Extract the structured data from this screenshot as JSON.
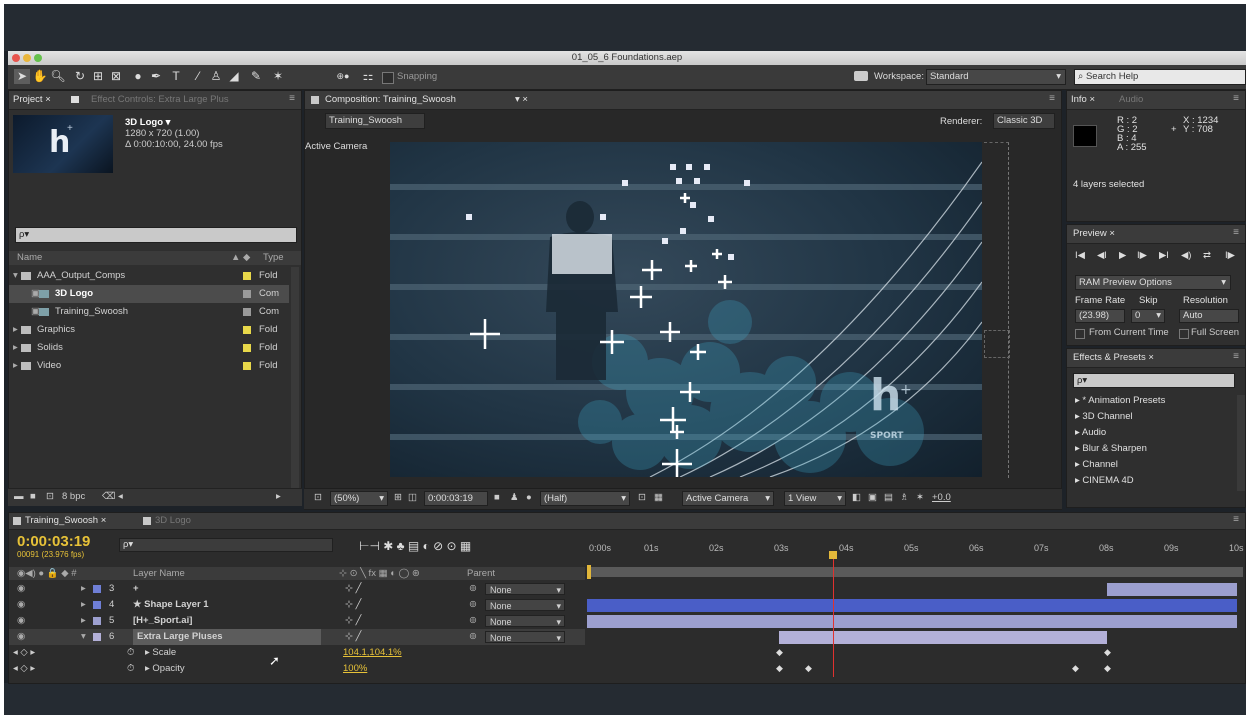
{
  "app": {
    "window_title": "01_05_6 Foundations.aep",
    "snapping_label": "Snapping",
    "workspace_label": "Workspace:",
    "workspace_value": "Standard",
    "search_placeholder": "Search Help"
  },
  "project_panel": {
    "tab_project": "Project ×",
    "tab_effect_controls": "Effect Controls: Extra Large Plus",
    "selected_name": "3D Logo ▾",
    "selected_dims": "1280 x 720 (1.00)",
    "selected_duration": "Δ 0:00:10:00, 24.00 fps",
    "search_value": "ρ▾",
    "col_name": "Name",
    "col_type": "Type",
    "items": [
      {
        "name": "AAA_Output_Comps",
        "type": "Fold",
        "indent": 0,
        "color": "#e8d84a"
      },
      {
        "name": "3D Logo",
        "type": "Com",
        "indent": 1,
        "color": "#9a9a9a"
      },
      {
        "name": "Training_Swoosh",
        "type": "Com",
        "indent": 1,
        "color": "#9a9a9a"
      },
      {
        "name": "Graphics",
        "type": "Fold",
        "indent": 0,
        "color": "#e8d84a"
      },
      {
        "name": "Solids",
        "type": "Fold",
        "indent": 0,
        "color": "#e8d84a"
      },
      {
        "name": "Video",
        "type": "Fold",
        "indent": 0,
        "color": "#e8d84a"
      }
    ],
    "bpc_label": "8 bpc"
  },
  "composition_panel": {
    "tab_title": "Composition: Training_Swoosh",
    "breadcrumb": "Training_Swoosh",
    "renderer_label": "Renderer:",
    "renderer_value": "Classic 3D",
    "camera_label": "Active Camera",
    "zoom_value": "(50%)",
    "timecode": "0:00:03:19",
    "resolution": "(Half)",
    "view_camera": "Active Camera",
    "view_count": "1 View",
    "exposure": "+0.0",
    "watermark": "SPORT"
  },
  "info_panel": {
    "tab_info": "Info ×",
    "tab_audio": "Audio",
    "r": "R : 2",
    "g": "G : 2",
    "b": "B : 4",
    "a": "A : 255",
    "x": "X : 1234",
    "y": "Y : 708",
    "status": "4 layers selected"
  },
  "preview_panel": {
    "tab": "Preview ×",
    "ram_options": "RAM Preview Options",
    "frame_rate_label": "Frame Rate",
    "skip_label": "Skip",
    "resolution_label": "Resolution",
    "frame_rate_value": "(23.98)",
    "skip_value": "0",
    "resolution_value": "Auto",
    "from_current": "From Current Time",
    "full_screen": "Full Screen"
  },
  "effects_panel": {
    "tab": "Effects & Presets ×",
    "search_value": "ρ▾",
    "items": [
      "* Animation Presets",
      "3D Channel",
      "Audio",
      "Blur & Sharpen",
      "Channel",
      "CINEMA 4D"
    ]
  },
  "timeline": {
    "tab_active": "Training_Swoosh ×",
    "tab_other": "3D Logo",
    "timecode": "0:00:03:19",
    "frame_info": "00091 (23.976 fps)",
    "search_value": "ρ▾",
    "col_layer_name": "Layer Name",
    "col_parent": "Parent",
    "ruler_labels": [
      "0:00s",
      "01s",
      "02s",
      "03s",
      "04s",
      "05s",
      "06s",
      "07s",
      "08s",
      "09s",
      "10s"
    ],
    "playhead_seconds": 3.79,
    "layers": [
      {
        "num": "3",
        "name": "+",
        "parent": "None",
        "color": "#6f7fd6"
      },
      {
        "num": "4",
        "name": "★ Shape Layer 1",
        "parent": "None",
        "color": "#6f7fd6"
      },
      {
        "num": "5",
        "name": "[H+_Sport.ai]",
        "parent": "None",
        "color": "#9c9fcf"
      },
      {
        "num": "6",
        "name": "Extra Large Pluses",
        "parent": "None",
        "color": "#b3b0d8"
      }
    ],
    "properties": [
      {
        "name": "Scale",
        "value": "104.1,104.1%"
      },
      {
        "name": "Opacity",
        "value": "100%"
      }
    ],
    "layer_bars": [
      {
        "start": 8.0,
        "end": 10.0,
        "color": "#9c9fcf"
      },
      {
        "start": 0.0,
        "end": 10.0,
        "color": "#4a5ec7"
      },
      {
        "start": 0.0,
        "end": 10.0,
        "color": "#9c9fcf"
      },
      {
        "start": 2.95,
        "end": 8.0,
        "color": "#b3b0d8"
      }
    ],
    "scale_keyframes": [
      2.95,
      8.0
    ],
    "opacity_keyframes": [
      2.95,
      3.4,
      7.5,
      8.0
    ]
  }
}
